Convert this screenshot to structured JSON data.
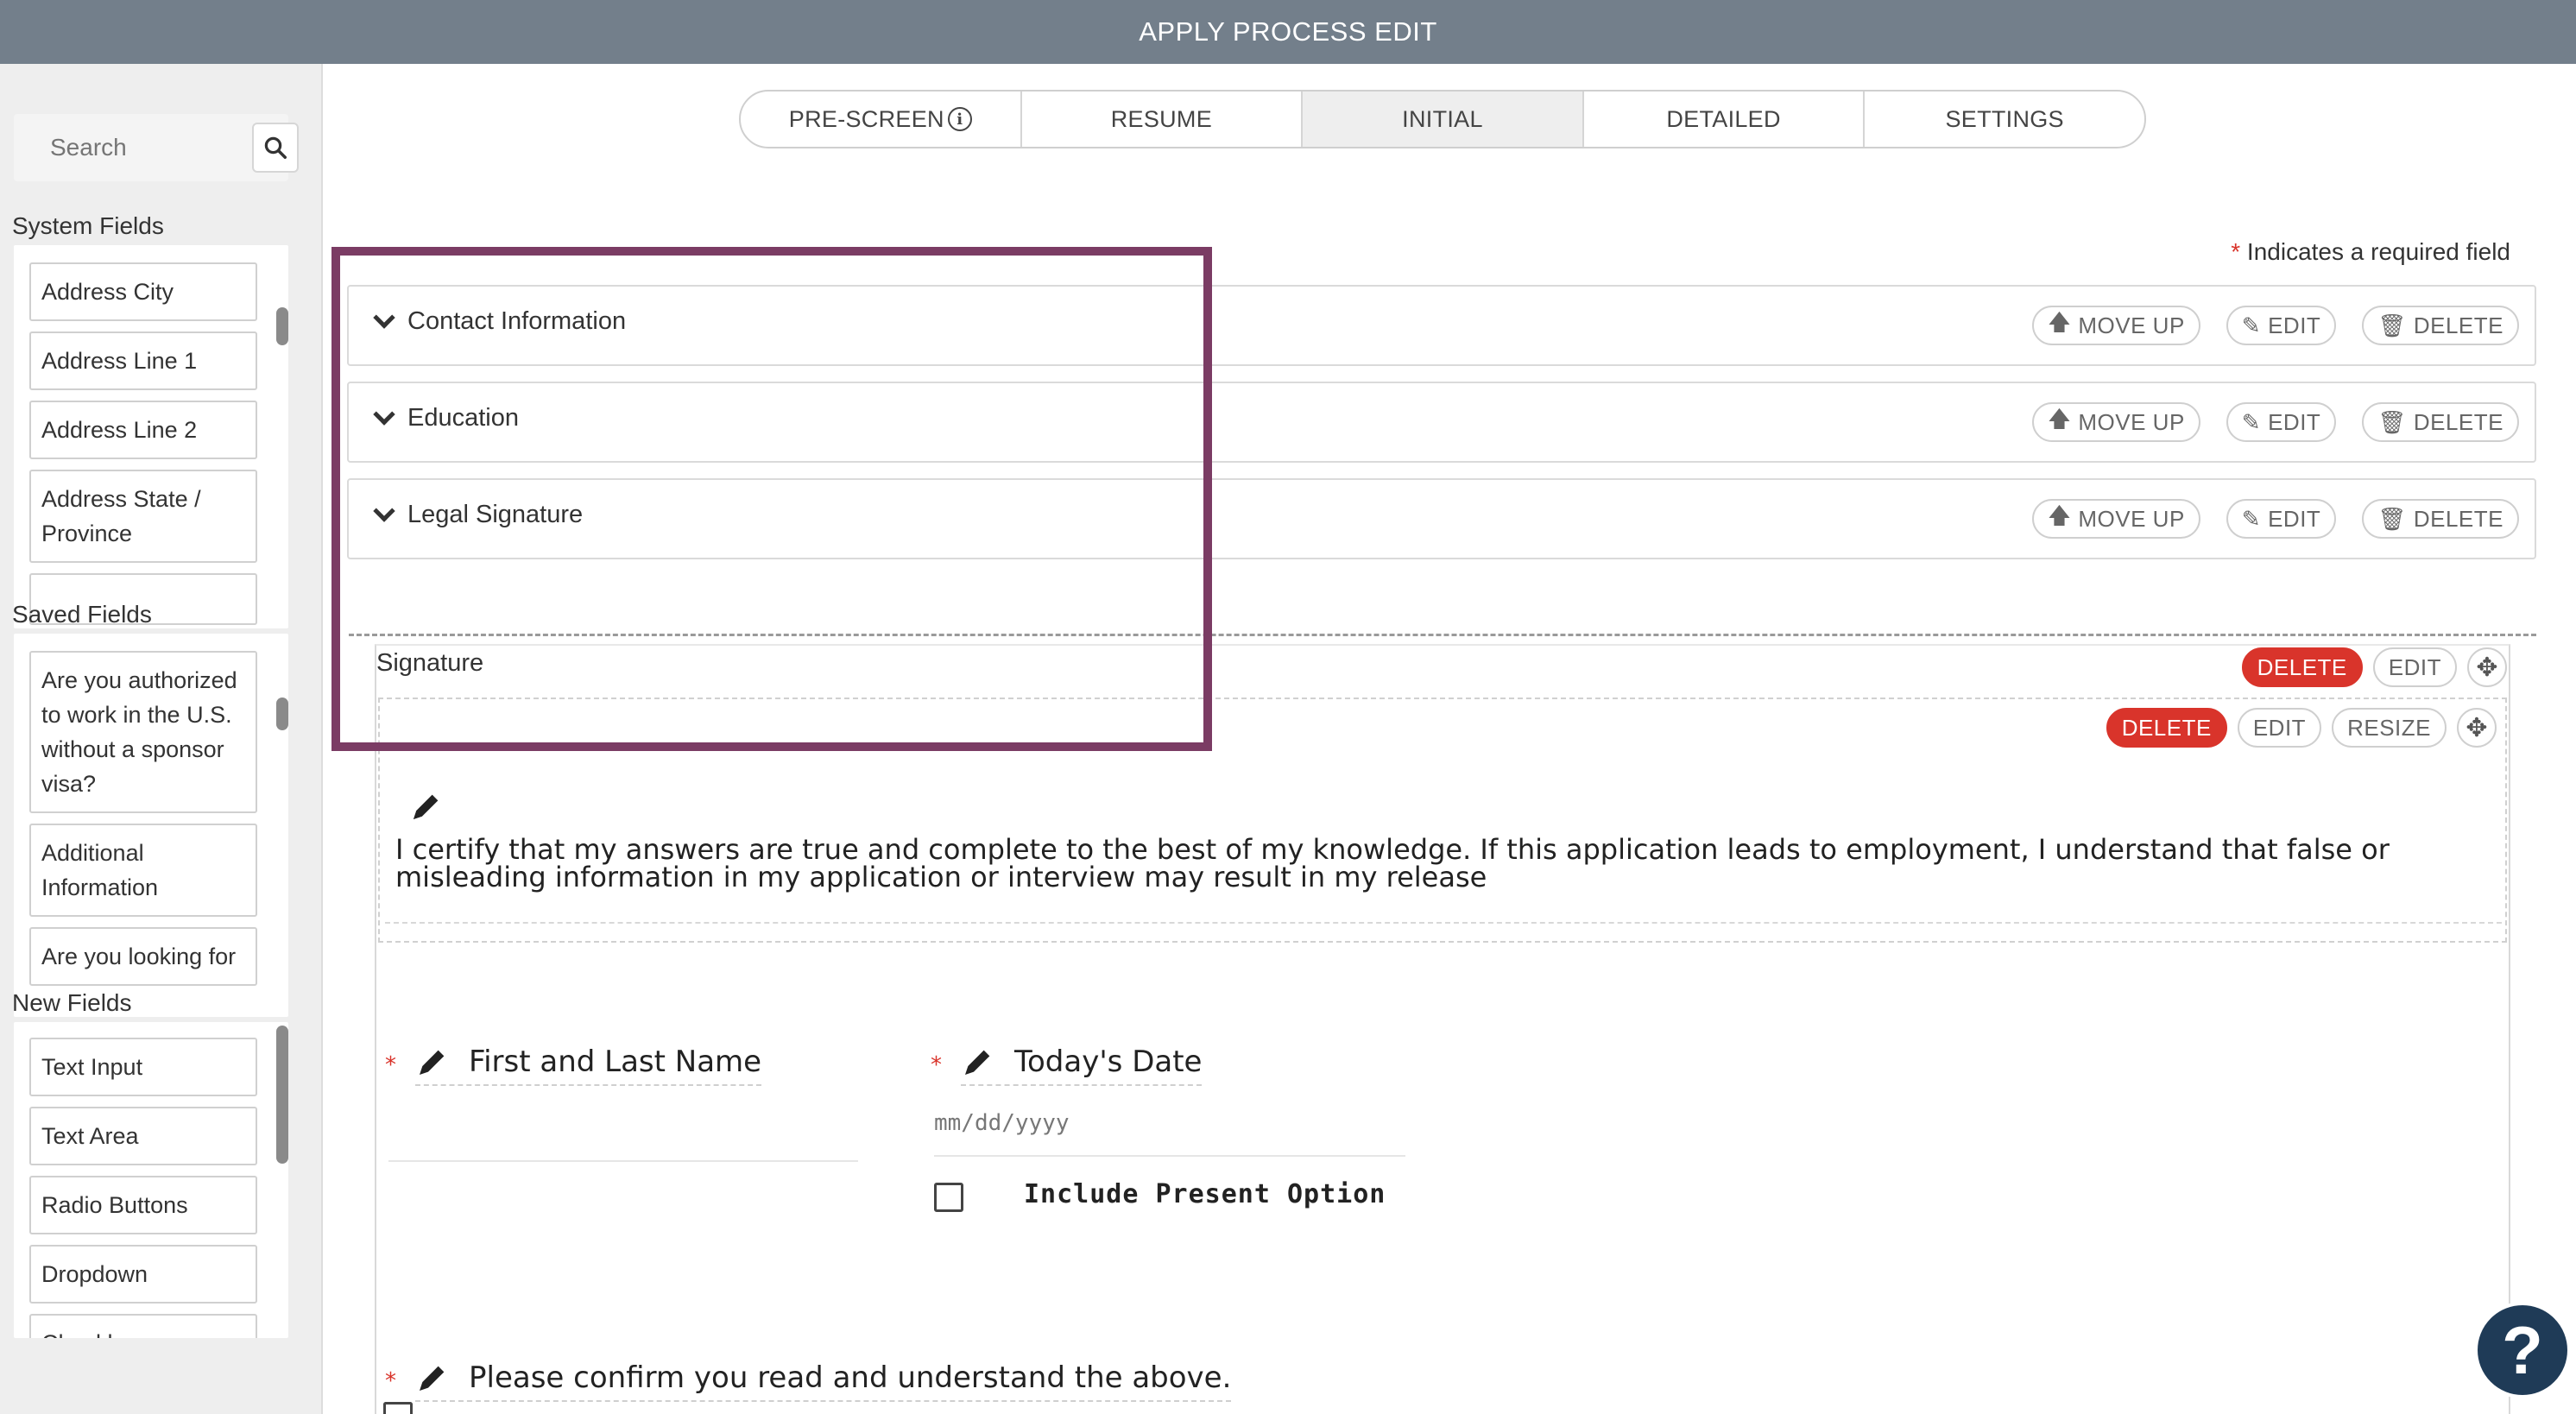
{
  "header": {
    "title": "APPLY PROCESS EDIT"
  },
  "sidebar": {
    "search": {
      "placeholder": "Search"
    },
    "system_fields": {
      "title": "System Fields",
      "items": [
        "Address City",
        "Address Line 1",
        "Address Line 2",
        "Address State / Province",
        ""
      ]
    },
    "saved_fields": {
      "title": "Saved Fields",
      "items": [
        "Are you authorized to work in the U.S. without a sponsor visa?",
        "Additional Information",
        "Are you looking for"
      ]
    },
    "new_fields": {
      "title": "New Fields",
      "items": [
        "Text Input",
        "Text Area",
        "Radio Buttons",
        "Dropdown",
        "Checkbox"
      ]
    }
  },
  "tabs": [
    {
      "label": "PRE-SCREEN",
      "active": false
    },
    {
      "label": "RESUME",
      "active": false
    },
    {
      "label": "INITIAL",
      "active": true
    },
    {
      "label": "DETAILED",
      "active": false
    },
    {
      "label": "SETTINGS",
      "active": false
    }
  ],
  "required_note": {
    "asterisk": "*",
    "text": "Indicates a required field"
  },
  "row_actions": {
    "move_up": "MOVE UP",
    "edit": "EDIT",
    "delete": "DELETE"
  },
  "sections": [
    {
      "title": "Contact Information"
    },
    {
      "title": "Education"
    },
    {
      "title": "Legal Signature"
    }
  ],
  "signature_block": {
    "label": "Signature",
    "delete": "DELETE",
    "edit": "EDIT",
    "resize": "RESIZE",
    "certification_text": "I certify that my answers are true and complete to the best of my knowledge. If this application leads to employment, I understand that false or misleading information in my application or interview may result in my release",
    "fields": {
      "name_label": "First and Last Name",
      "date_label": "Today's Date",
      "date_placeholder": "mm/dd/yyyy",
      "present_option": "Include Present Option",
      "confirm_label": "Please confirm you read and understand the above."
    }
  },
  "help": {
    "label": "?"
  },
  "colors": {
    "topbar": "#737f8b",
    "highlight": "#7b3c64",
    "danger": "#d9342b",
    "help": "#1f3b57"
  }
}
